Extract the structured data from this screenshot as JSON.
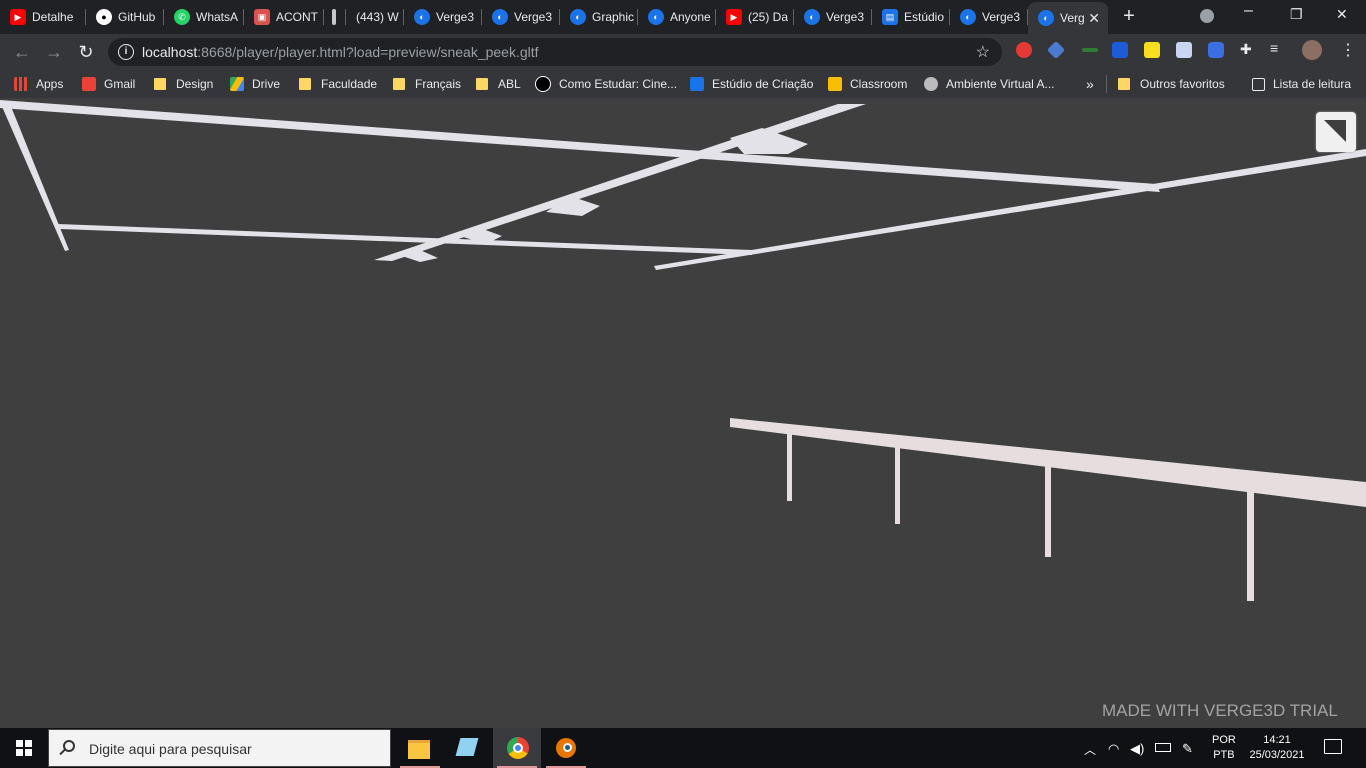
{
  "tabs": [
    {
      "title": "Detalhe",
      "icon": "youtube-icon"
    },
    {
      "title": "GitHub",
      "icon": "github-icon"
    },
    {
      "title": "WhatsA",
      "icon": "whatsapp-icon"
    },
    {
      "title": "ACONT",
      "icon": "acont-icon"
    },
    {
      "title": "",
      "icon": "pill-icon"
    },
    {
      "title": "(443) W",
      "icon": "blank-icon"
    },
    {
      "title": "Verge3",
      "icon": "verge3d-icon"
    },
    {
      "title": "Verge3",
      "icon": "verge3d-icon"
    },
    {
      "title": "Graphic",
      "icon": "verge3d-icon"
    },
    {
      "title": "Anyone",
      "icon": "verge3d-icon"
    },
    {
      "title": "(25) Da",
      "icon": "youtube-icon"
    },
    {
      "title": "Verge3",
      "icon": "verge3d-icon"
    },
    {
      "title": "Estúdio",
      "icon": "clapper-icon"
    },
    {
      "title": "Verge3",
      "icon": "verge3d-icon"
    },
    {
      "title": "Verg",
      "icon": "verge3d-icon",
      "active": true
    }
  ],
  "address": {
    "host": "localhost",
    "rest": ":8668/player/player.html?load=preview/sneak_peek.gltf"
  },
  "bookmarks": [
    {
      "label": "Apps"
    },
    {
      "label": "Gmail"
    },
    {
      "label": "Design"
    },
    {
      "label": "Drive"
    },
    {
      "label": "Faculdade"
    },
    {
      "label": "Français"
    },
    {
      "label": "ABL"
    },
    {
      "label": "Como Estudar: Cine..."
    },
    {
      "label": "Estúdio de Criação"
    },
    {
      "label": "Classroom"
    },
    {
      "label": "Ambiente Virtual A..."
    }
  ],
  "bookmarks_more": "»",
  "other_bookmarks": "Outros favoritos",
  "reading_list": "Lista de leitura",
  "viewport": {
    "watermark": "MADE WITH VERGE3D TRIAL"
  },
  "taskbar": {
    "search_placeholder": "Digite aqui para pesquisar",
    "lang_top": "POR",
    "lang_bottom": "PTB",
    "time": "14:21",
    "date": "25/03/2021"
  },
  "colors": {
    "accent_blue": "#1a73e8",
    "scene_bg": "#3f3f3f",
    "rail": "#e6dede"
  }
}
